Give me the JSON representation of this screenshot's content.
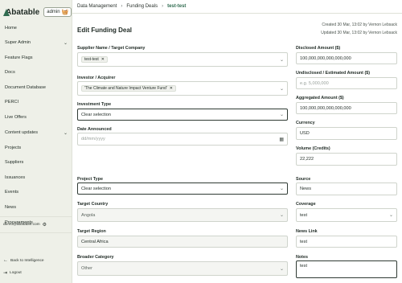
{
  "brand": {
    "name": "Abatable",
    "admin_label": "admin"
  },
  "sidebar": {
    "items": [
      {
        "label": "Home"
      },
      {
        "label": "Super Admin"
      },
      {
        "label": "Feature Flags"
      },
      {
        "label": "Docs"
      },
      {
        "label": "Document Database"
      },
      {
        "label": "PERCI"
      },
      {
        "label": "Live Offers"
      },
      {
        "label": "Content updates"
      },
      {
        "label": "Projects"
      },
      {
        "label": "Suppliers"
      },
      {
        "label": "Issuances"
      },
      {
        "label": "Events"
      },
      {
        "label": "News"
      },
      {
        "label": "Procurements"
      }
    ],
    "user_email": "demo@abatable.com",
    "back_label": "Back to Intelligence",
    "logout_label": "Logout"
  },
  "breadcrumb": [
    "Data Management",
    "Funding Deals",
    "test-test"
  ],
  "page": {
    "title": "Edit Funding Deal",
    "created": "Created 30 Mar, 13:02 by Vernon Lebsack",
    "updated": "Updated 30 Mar, 13:02 by Vernon Lebsack"
  },
  "form": {
    "supplier": {
      "label": "Supplier Name / Target Company",
      "tag": "test-test"
    },
    "investor": {
      "label": "Investor / Acquirer",
      "tag": "'The Climate and Nature Impact Venture Fund'"
    },
    "investment_type": {
      "label": "Investment Type",
      "value": "Clear selection"
    },
    "date_announced": {
      "label": "Date Announced",
      "placeholder": "dd/mm/yyyy"
    },
    "project_type": {
      "label": "Project Type",
      "value": "Clear selection"
    },
    "target_country": {
      "label": "Target Country",
      "value": "Angola"
    },
    "target_region": {
      "label": "Target Region",
      "value": "Central Africa"
    },
    "broader_category": {
      "label": "Broader Category",
      "value": "Other"
    },
    "disclosed_amount": {
      "label": "Disclosed Amount ($)",
      "value": "100,000,000,000,000,000"
    },
    "undisclosed_amount": {
      "label": "Undisclosed / Estimated Amount ($)",
      "placeholder": "e.g. 5,000,000"
    },
    "aggregated_amount": {
      "label": "Aggregated Amount ($)",
      "value": "100,000,000,000,000,000"
    },
    "currency": {
      "label": "Currency",
      "value": "USD"
    },
    "volume": {
      "label": "Volume (Credits)",
      "value": "22,222"
    },
    "source": {
      "label": "Source",
      "value": "News"
    },
    "coverage": {
      "label": "Coverage",
      "value": "test"
    },
    "news_link": {
      "label": "News Link",
      "value": "test"
    },
    "notes": {
      "label": "Notes",
      "value": "test"
    }
  }
}
